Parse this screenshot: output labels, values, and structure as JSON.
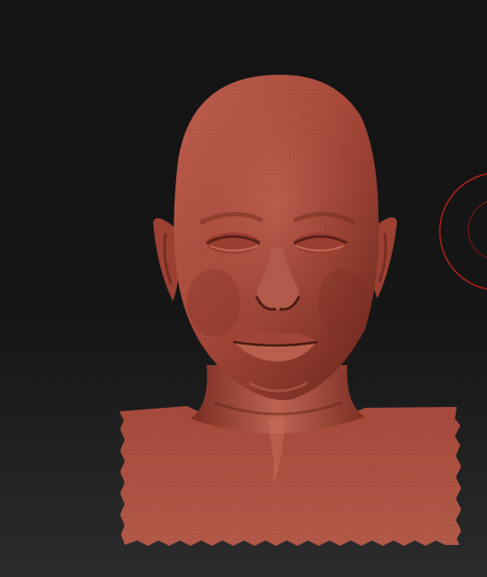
{
  "viewport": {
    "background_top": "#141414",
    "background_bottom": "#2b2b2b"
  },
  "model": {
    "material_color": "#a5483a",
    "material_highlight": "#c86a58",
    "material_shadow": "#4e1c15",
    "wireframe_color": "#6e2a20"
  },
  "brush_cursor": {
    "color": "#b3221a"
  }
}
